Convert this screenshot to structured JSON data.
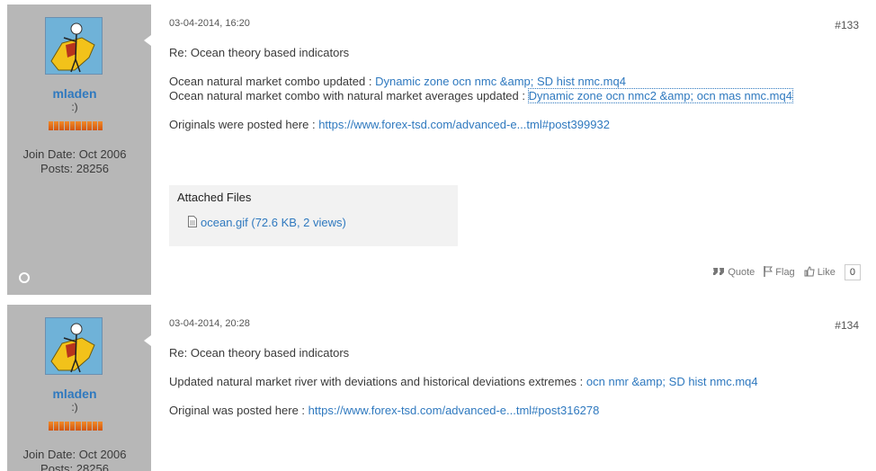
{
  "posts": [
    {
      "username": "mladen",
      "user_title": ":)",
      "join_date": "Join Date: Oct 2006",
      "posts_count": "Posts: 28256",
      "date": "03-04-2014, 16:20",
      "post_number": "#133",
      "title": "Re: Ocean theory based indicators",
      "line1_text": "Ocean natural market combo updated : ",
      "line1_link": "Dynamic zone ocn nmc &amp; SD hist nmc.mq4",
      "line2_text": "Ocean natural market combo with natural market averages updated : ",
      "line2_link": "Dynamic zone ocn nmc2 &amp; ocn mas nmc.mq4",
      "line3_text": "Originals were posted here : ",
      "line3_link": "https://www.forex-tsd.com/advanced-e...tml#post399932",
      "attachments_title": "Attached Files",
      "attachment": "ocean.gif (72.6 KB, 2 views)",
      "quote_label": "Quote",
      "flag_label": "Flag",
      "like_label": "Like",
      "like_count": "0"
    },
    {
      "username": "mladen",
      "user_title": ":)",
      "join_date": "Join Date: Oct 2006",
      "posts_count": "Posts: 28256",
      "date": "03-04-2014, 20:28",
      "post_number": "#134",
      "title": "Re: Ocean theory based indicators",
      "line1_text": "Updated natural market river with deviations and historical deviations extremes : ",
      "line1_link": "ocn nmr &amp; SD hist nmc.mq4",
      "line3_text": "Original was posted here : ",
      "line3_link": "https://www.forex-tsd.com/advanced-e...tml#post316278"
    }
  ],
  "colors": {
    "sidebar": "#b7b7b7",
    "link": "#2f79bf",
    "attachment_bg": "#f2f2f2"
  }
}
